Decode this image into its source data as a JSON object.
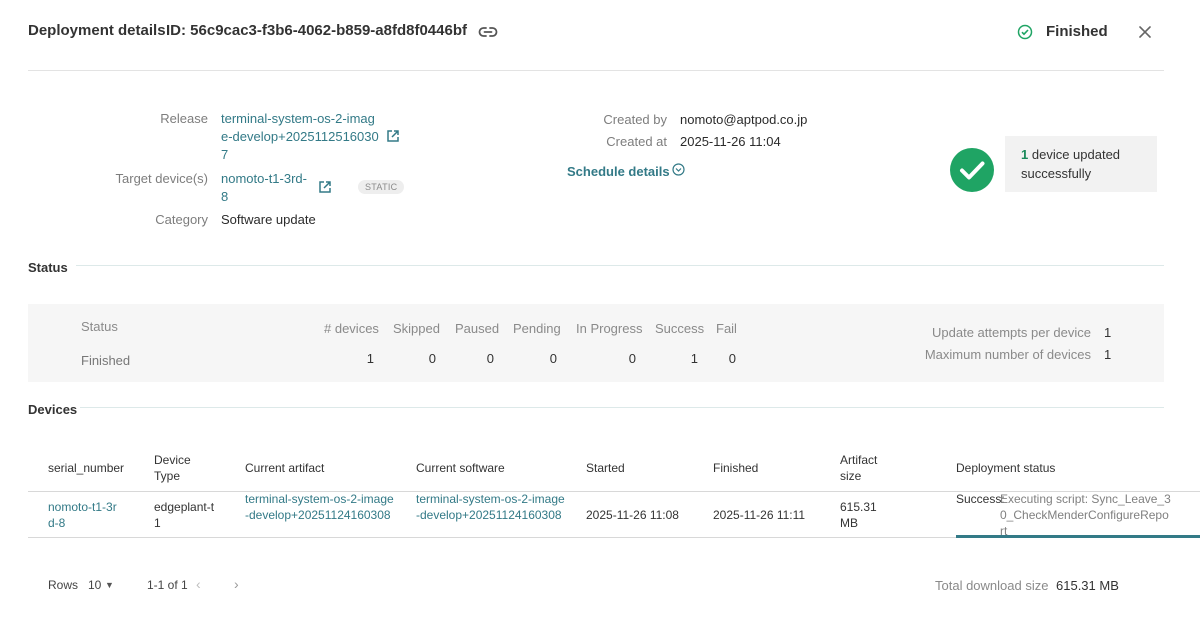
{
  "header": {
    "title": "Deployment details",
    "id": "ID: 56c9cac3-f3b6-4062-b859-a8fd8f0446bf",
    "status": "Finished"
  },
  "summary": {
    "release_label": "Release",
    "release_value": "terminal-system-os-2-image-develop+20251125160307",
    "target_label": "Target device(s)",
    "target_value": "nomoto-t1-3rd-8",
    "target_badge": "STATIC",
    "category_label": "Category",
    "category_value": "Software update",
    "created_by_label": "Created by",
    "created_by_value": "nomoto@aptpod.co.jp",
    "created_at_label": "Created at",
    "created_at_value": "2025-11-26 11:04",
    "schedule_label": "Schedule details",
    "updated_count": "1",
    "updated_text": "device updated successfully"
  },
  "status_section": {
    "title": "Status",
    "status_header": "Status",
    "status_value": "Finished",
    "columns": [
      {
        "label": "# devices",
        "value": "1"
      },
      {
        "label": "Skipped",
        "value": "0"
      },
      {
        "label": "Paused",
        "value": "0"
      },
      {
        "label": "Pending",
        "value": "0"
      },
      {
        "label": "In Progress",
        "value": "0"
      },
      {
        "label": "Success",
        "value": "1"
      },
      {
        "label": "Fail",
        "value": "0"
      }
    ],
    "update_attempts_label": "Update attempts per device",
    "update_attempts_value": "1",
    "max_devices_label": "Maximum number of devices",
    "max_devices_value": "1"
  },
  "devices_section": {
    "title": "Devices",
    "columns": [
      "serial_number",
      "Device Type",
      "Current artifact",
      "Current software",
      "Started",
      "Finished",
      "Artifact size",
      "Deployment status"
    ],
    "rows": [
      {
        "serial_number": "nomoto-t1-3rd-8",
        "device_type": "edgeplant-t1",
        "current_artifact": "terminal-system-os-2-image-develop+20251124160308",
        "current_software": "terminal-system-os-2-image-develop+20251124160308",
        "started": "2025-11-26 11:08",
        "finished": "2025-11-26 11:11",
        "artifact_size": "615.31 MB",
        "status_label": "Success:",
        "status_detail": "Executing script: Sync_Leave_30_CheckMenderConfigureReport",
        "progress": 1.0
      }
    ]
  },
  "footer": {
    "rows_label": "Rows",
    "rows_value": "10",
    "range": "1-1 of 1",
    "total_download_label": "Total download size",
    "total_download_value": "615.31 MB"
  },
  "colors": {
    "accent": "#337a87",
    "success": "#1fa464"
  }
}
